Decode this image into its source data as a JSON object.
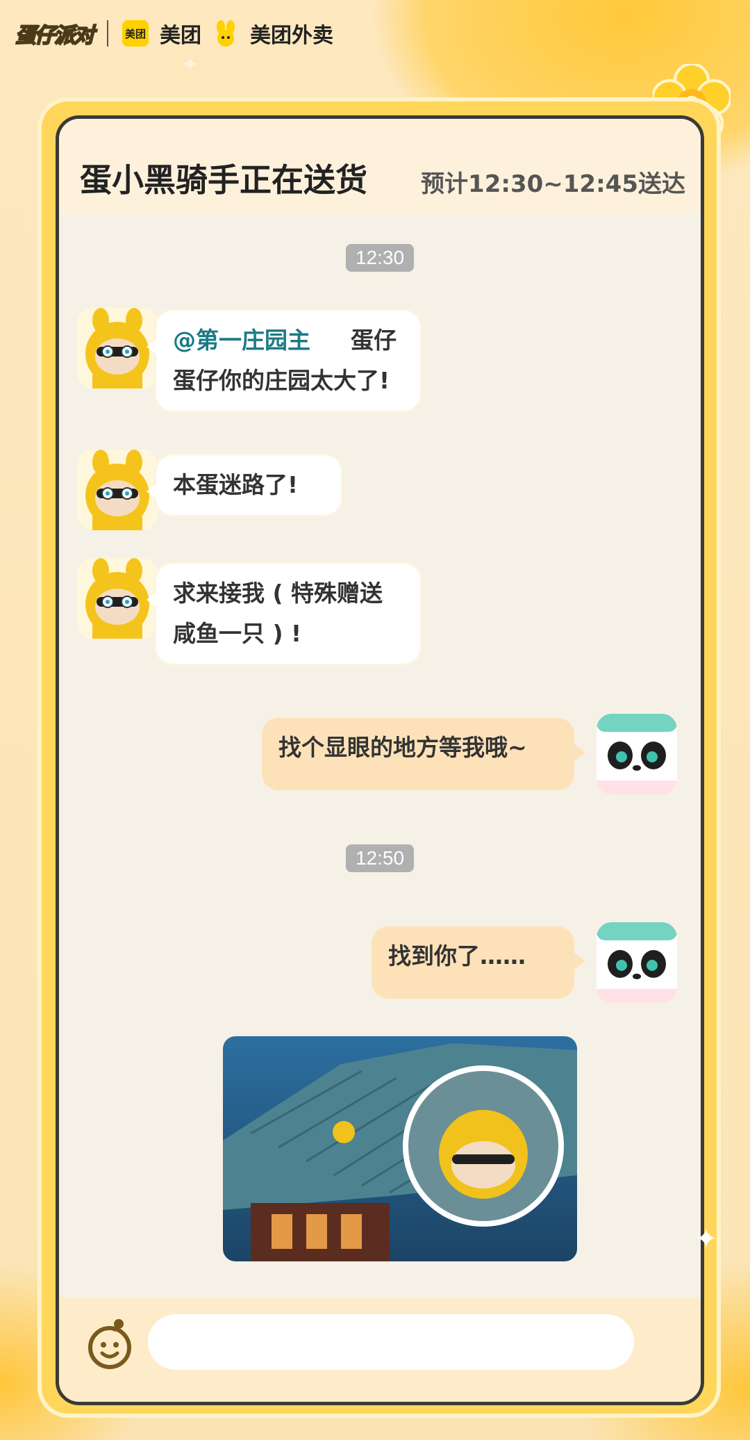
{
  "header": {
    "game_logo": "蛋仔派对",
    "meituan_badge": "美团",
    "meituan_label": "美团",
    "waimai_label": "美团外卖"
  },
  "chat": {
    "title": "蛋小黑骑手正在送货",
    "eta": "预计12:30~12:45送达",
    "timestamps": [
      "12:30",
      "12:50"
    ],
    "messages": [
      {
        "side": "left",
        "mention": "@第一庄园主",
        "text": "蛋仔蛋仔你的庄园太大了!",
        "avatar": "yellow-bunny-eggy-avatar"
      },
      {
        "side": "left",
        "text": "本蛋迷路了!",
        "avatar": "yellow-bunny-eggy-avatar"
      },
      {
        "side": "left",
        "text": "求来接我 ( 特殊赠送咸鱼一只 ) !",
        "avatar": "yellow-bunny-eggy-avatar"
      },
      {
        "side": "right",
        "text": "找个显眼的地方等我哦~",
        "avatar": "panda-eggy-avatar"
      },
      {
        "side": "right",
        "text": "找到你了……",
        "avatar": "panda-eggy-avatar"
      }
    ],
    "photo": "rooftop-screenshot-image"
  },
  "input": {
    "placeholder": "",
    "icon": "eggy-face-icon"
  },
  "colors": {
    "accent_yellow": "#ffd65a",
    "mention_teal": "#1b7a86",
    "right_bubble": "#fde2b9",
    "frame_dark": "#3b3a36"
  }
}
